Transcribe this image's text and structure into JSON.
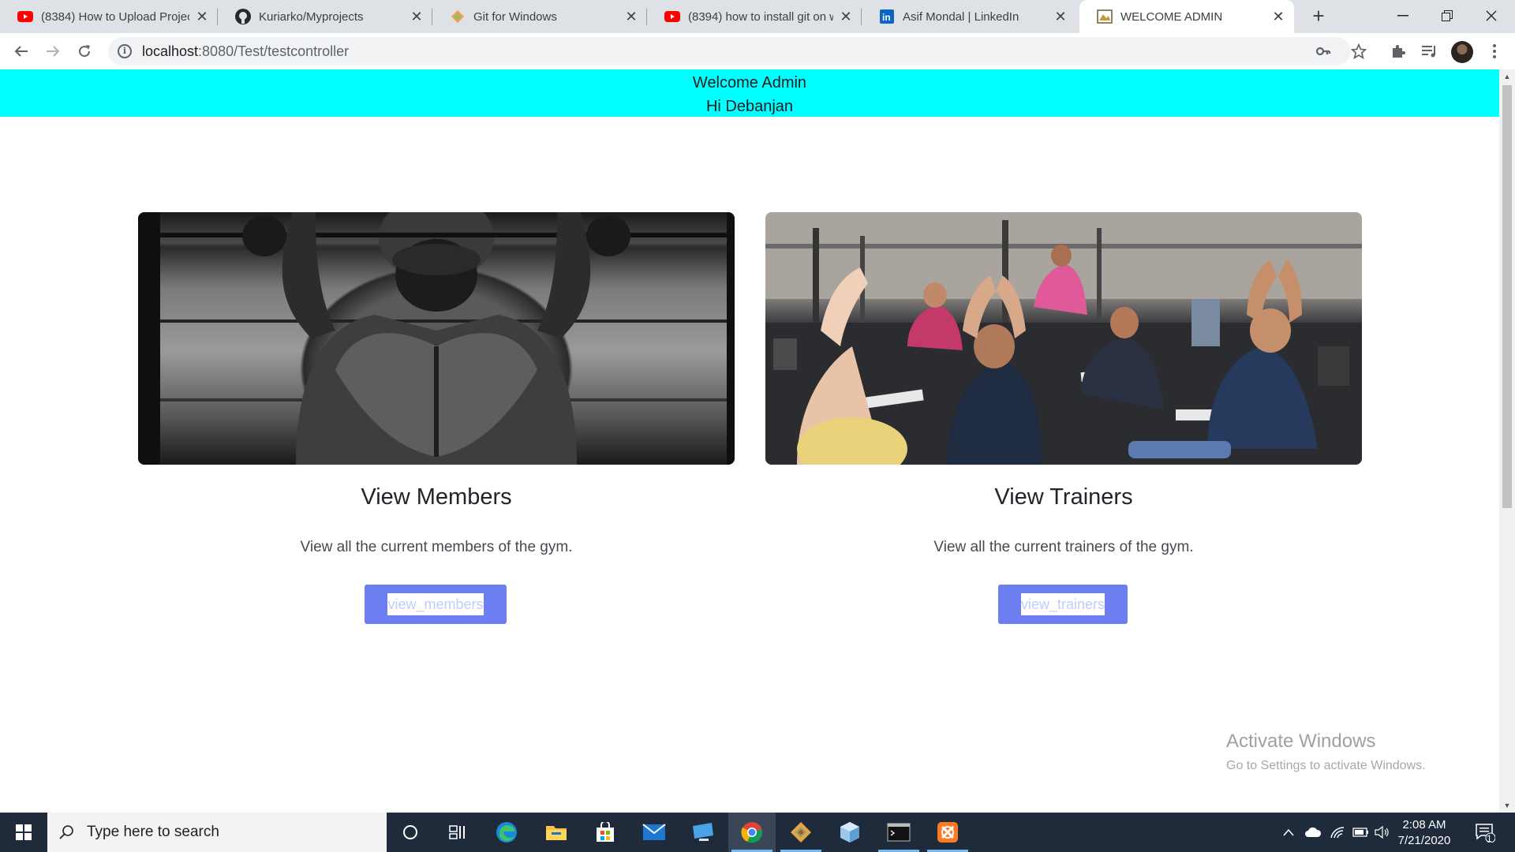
{
  "browser": {
    "tabs": [
      {
        "title": "(8384) How to Upload Projec",
        "favicon": "youtube-icon",
        "active": false
      },
      {
        "title": "Kuriarko/Myprojects",
        "favicon": "github-icon",
        "active": false
      },
      {
        "title": "Git for Windows",
        "favicon": "git-for-windows-icon",
        "active": false
      },
      {
        "title": "(8394) how to install git on w",
        "favicon": "youtube-icon",
        "active": false
      },
      {
        "title": "Asif Mondal | LinkedIn",
        "favicon": "linkedin-icon",
        "active": false
      },
      {
        "title": "WELCOME ADMIN",
        "favicon": "page-icon",
        "active": true
      }
    ],
    "url_host": "localhost",
    "url_path": ":8080/Test/testcontroller"
  },
  "page": {
    "banner_line1": "Welcome Admin",
    "banner_line2": "Hi Debanjan",
    "cards": [
      {
        "title": "View Members",
        "text": "View all the current members of the gym.",
        "button_label": "view_members",
        "image": "man-doing-pull-ups-photo"
      },
      {
        "title": "View Trainers",
        "text": "View all the current trainers of the gym.",
        "button_label": "view_trainers",
        "image": "group-fitness-class-photo"
      }
    ]
  },
  "watermark": {
    "line1": "Activate Windows",
    "line2": "Go to Settings to activate Windows."
  },
  "taskbar": {
    "search_placeholder": "Type here to search",
    "time": "2:08 AM",
    "date": "7/21/2020",
    "notification_count": "1"
  },
  "colors": {
    "banner": "#00ffff",
    "button": "#6d7ff0",
    "taskbar": "#1f2a3a"
  }
}
